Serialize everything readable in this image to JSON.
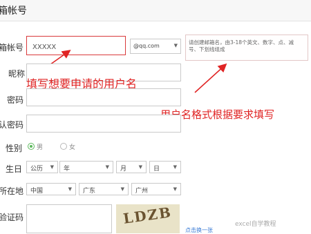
{
  "header": {
    "title": "箱帐号"
  },
  "form": {
    "account": {
      "label": "箱帐号",
      "value": "XXXXX",
      "domain": "@qq.com"
    },
    "hint": "请创建邮箱名，由3-18个英文、数字、点、减号、下划线组成",
    "nickname": {
      "label": "昵称"
    },
    "password": {
      "label": "密码"
    },
    "confirm_password": {
      "label": "认密码"
    },
    "gender": {
      "label": "性别",
      "options": [
        "男",
        "女"
      ],
      "selected": "男"
    },
    "birthday": {
      "label": "生日",
      "calendar": "公历",
      "year": "年",
      "month": "月",
      "day": "日"
    },
    "location": {
      "label": "所在地",
      "country": "中国",
      "province": "广东",
      "city": "广州"
    },
    "captcha": {
      "label": "验证码",
      "code": "LDZB",
      "refresh": "点击换一张"
    }
  },
  "annotations": {
    "username": "填写想要申请的用户名",
    "format": "用户名格式根据要求填写"
  },
  "watermark": "excel自学教程",
  "colors": {
    "annotation": "#e02424",
    "active_border": "#d9393a",
    "radio_on": "#5cb85c"
  }
}
